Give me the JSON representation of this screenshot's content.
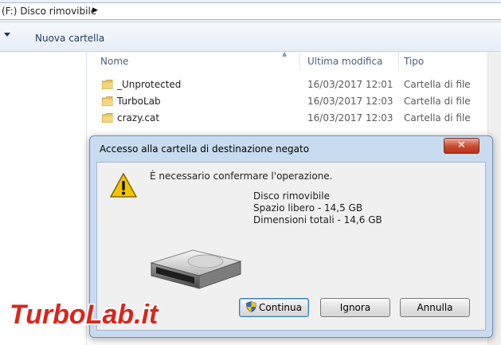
{
  "address_bar": {
    "path": "(F:) Disco rimovibile"
  },
  "toolbar": {
    "new_folder_label": "Nuova cartella"
  },
  "file_list": {
    "columns": [
      "Nome",
      "Ultima modifica",
      "Tipo"
    ],
    "rows": [
      {
        "name": "_Unprotected",
        "modified": "16/03/2017 12:01",
        "type": "Cartella di file"
      },
      {
        "name": "TurboLab",
        "modified": "16/03/2017 12:03",
        "type": "Cartella di file"
      },
      {
        "name": "crazy.cat",
        "modified": "16/03/2017 12:03",
        "type": "Cartella di file"
      }
    ]
  },
  "dialog": {
    "title": "Accesso alla cartella di destinazione negato",
    "close_label": "✕",
    "message": "È necessario confermare l'operazione.",
    "details": [
      "Disco rimovibile",
      "Spazio libero - 14,5 GB",
      "Dimensioni totali - 14,6 GB"
    ],
    "buttons": {
      "continue": "Continua",
      "ignore": "Ignora",
      "cancel": "Annulla"
    }
  },
  "watermark": {
    "text": "TurboLab.it"
  },
  "colors": {
    "folder": "#e8c25a",
    "warning": "#f2c500",
    "watermark_red": "#d8261c",
    "dialog_frame": "#c9dbef"
  }
}
